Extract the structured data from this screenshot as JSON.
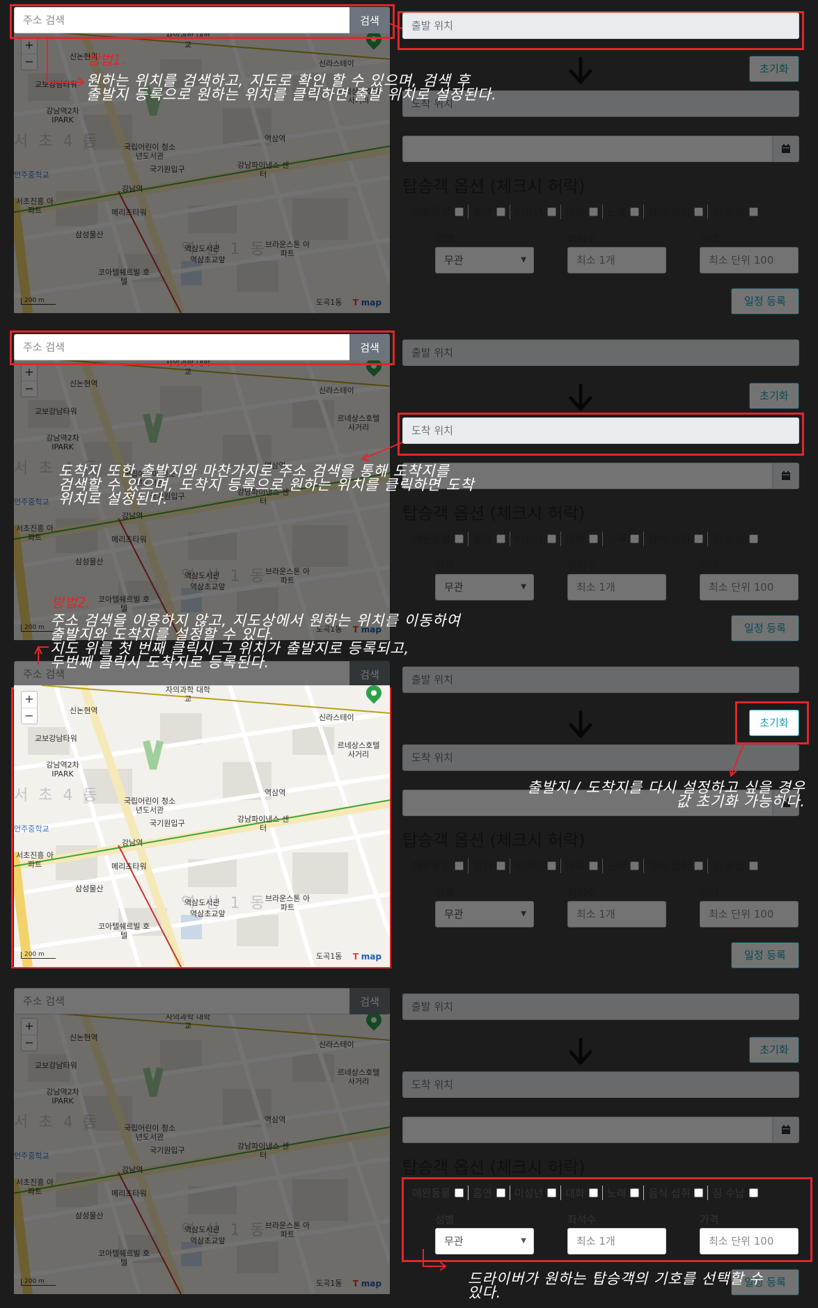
{
  "search": {
    "placeholder": "주소 검색",
    "button": "검색"
  },
  "form": {
    "start_placeholder": "출발 위치",
    "end_placeholder": "도착 위치",
    "reset_button": "초기화",
    "options_title": "탑승객 옵션 (체크시 허락)",
    "options": [
      "애완동물",
      "흡연",
      "미성년",
      "대화",
      "노래",
      "음식 섭취",
      "짐 수납"
    ],
    "gender_label": "성별",
    "gender_value": "무관",
    "seats_label": "좌석수",
    "seats_placeholder": "최소 1개",
    "price_label": "가격",
    "price_placeholder": "최소 단위 100",
    "register_button": "일정 등록"
  },
  "map": {
    "zoom_in": "+",
    "zoom_out": "−",
    "scale": "200 m",
    "brand": "map",
    "labels": {
      "l1": "자의과학 대학교",
      "l2": "신논현역",
      "l3": "교보강남타워",
      "l4": "강남역2차 IPARK",
      "l5": "국립어린이 청소년도서관",
      "l6": "국기원입구",
      "l7": "역삼역",
      "l8": "강남파이낸스 센터",
      "l9": "강남역",
      "l10": "메리츠타워",
      "l11": "삼성물산",
      "l12": "역삼도서관",
      "l13": "역삼초교앞",
      "l14": "브라운스톤 아파트",
      "l15": "코아텔쉐르빌 호텔",
      "l16": "신라스테이",
      "l17": "르네상스호텔 사거리",
      "l18": "서초진흥 아파트",
      "l19": "언주중학교",
      "l20": "도곡1동",
      "l21": "서 초 4 동",
      "l22": "역 삼 1 동"
    }
  },
  "annotations": {
    "method1": "방법1.",
    "text1_line1": "원하는 위치를 검색하고, 지도로 확인 할 수 있으며, 검색 후",
    "text1_line2": "출발지 등록으로 원하는 위치를 클릭하면 출발 위치로 설정된다.",
    "text2_line1": "도착지 또한 출발지와 마찬가지로 주소 검색을 통해 도착지를",
    "text2_line2": "검색할 수 있으며, 도착지 등록으로 원하는 위치를 클릭하면 도착",
    "text2_line3": "위치로 설정된다.",
    "method2": "방법2.",
    "text3_line1": "주소 검색을 이용하지 않고, 지도상에서 원하는 위치를 이동하여",
    "text3_line2": "출발지와 도착지를 설정할 수 있다.",
    "text3_line3": "지도 위를 첫 번째 클릭시 그 위치가 출발지로 등록되고,",
    "text3_line4": "두번째 클릭시 도착지로 등록된다.",
    "text4_line1": "출발지 / 도착지를 다시 설정하고 싶을 경우",
    "text4_line2": "값 초기화 가능하다.",
    "text5_line1": "드라이버가 원하는 탑승객의 기호를 선택할 수",
    "text5_line2": "있다."
  },
  "colors": {
    "accent_red": "#e0262b",
    "teal_button": "#17a2b8",
    "search_button": "#6c757d",
    "map_pin": "#2ea04a"
  }
}
